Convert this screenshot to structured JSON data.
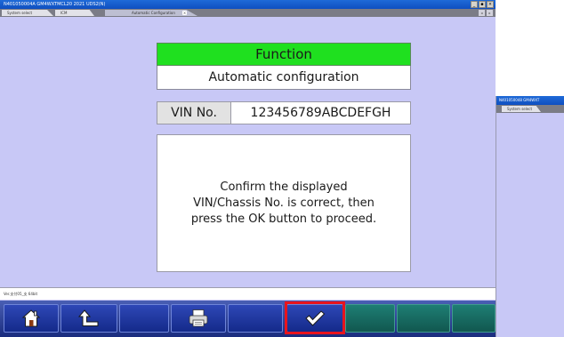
{
  "window": {
    "title": "N401050004A GM4WXTMCL20 2021 UDS2(N)",
    "controls": [
      "_",
      "▪",
      "×"
    ]
  },
  "tabs": [
    {
      "label": "System select"
    },
    {
      "label": "ICM"
    },
    {
      "label": "Automatic Configuration",
      "active": true,
      "close": "×"
    }
  ],
  "tab_scroll": {
    "left": "◂",
    "right": "▸"
  },
  "function_dialog": {
    "header": "Function",
    "name": "Automatic configuration",
    "vin_label": "VIN No.",
    "vin_value": "123456789ABCDEFGH",
    "message_lines": [
      "Confirm the displayed",
      "VIN/Chassis No. is correct, then",
      "press the OK button to proceed."
    ]
  },
  "status_bar": {
    "text": "Ver.支付05_支 64bit"
  },
  "footer": {
    "buttons": [
      {
        "name": "home-button",
        "icon": "home-icon",
        "enabled": true
      },
      {
        "name": "back-button",
        "icon": "return-arrow-icon",
        "enabled": true
      },
      {
        "name": "blank-button-1",
        "icon": "",
        "enabled": true
      },
      {
        "name": "print-button",
        "icon": "printer-icon",
        "enabled": true
      },
      {
        "name": "blank-button-2",
        "icon": "",
        "enabled": true
      },
      {
        "name": "ok-button",
        "icon": "checkmark-icon",
        "enabled": true,
        "highlighted": true
      },
      {
        "name": "blank-button-3",
        "icon": "",
        "enabled": false
      },
      {
        "name": "blank-button-4",
        "icon": "",
        "enabled": false
      },
      {
        "name": "blank-button-5",
        "icon": "",
        "enabled": false
      }
    ],
    "highlight_color": "#e8141e"
  },
  "secondary_window": {
    "title": "N401050048 GM4WXT",
    "tab": "System select"
  },
  "colors": {
    "background": "#c8c8f6",
    "header_green": "#1fe01f",
    "titlebar_blue": "#1a5fcf",
    "footer_blue": "#1a2c7e"
  }
}
